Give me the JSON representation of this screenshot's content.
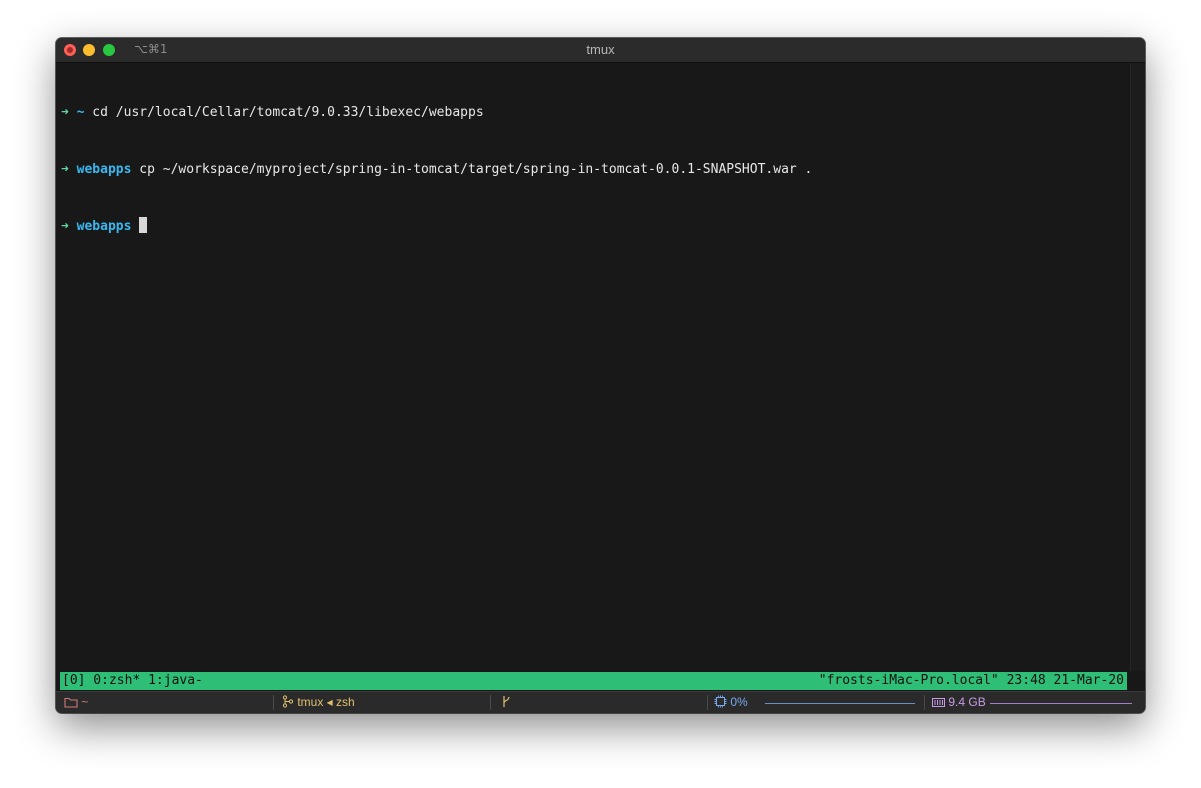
{
  "window": {
    "title": "tmux",
    "shortcut": "⌥⌘1"
  },
  "terminal": {
    "lines": [
      {
        "arrow": "➜",
        "dir": "~",
        "command": " cd /usr/local/Cellar/tomcat/9.0.33/libexec/webapps"
      },
      {
        "arrow": "➜",
        "dir": "webapps",
        "command": " cp ~/workspace/myproject/spring-in-tomcat/target/spring-in-tomcat-0.0.1-SNAPSHOT.war ."
      },
      {
        "arrow": "➜",
        "dir": "webapps",
        "command": " "
      }
    ],
    "colors": {
      "background": "#181818",
      "arrow": "#5fd7a0",
      "directory": "#39b8f0",
      "text": "#e8e8e8"
    }
  },
  "tmux_status": {
    "left": "[0] 0:zsh* 1:java-",
    "right": "\"frosts-iMac-Pro.local\" 23:48 21-Mar-20",
    "color": "#2ebe76"
  },
  "bottom_bar": {
    "folder": {
      "icon": "folder-icon",
      "label": "~"
    },
    "session": {
      "icon": "tmux-icon",
      "label": "tmux ◂ zsh"
    },
    "git": {
      "icon": "git-branch-icon",
      "label": ""
    },
    "cpu": {
      "icon": "cpu-icon",
      "label": "0%"
    },
    "memory": {
      "icon": "memory-icon",
      "label": "9.4 GB"
    }
  }
}
